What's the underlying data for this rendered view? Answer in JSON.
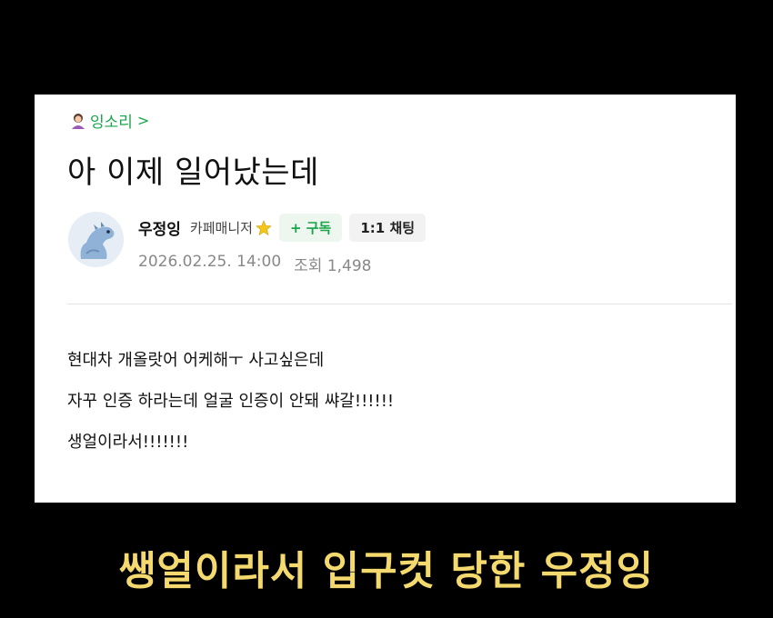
{
  "post": {
    "category": "잉소리",
    "category_chevron": ">",
    "title": "아 이제 일어났는데",
    "author": {
      "name": "우정잉",
      "role": "카페매니저",
      "subscribe_label": "+ 구독",
      "chat_label": "1:1 채팅"
    },
    "date": "2026.02.25. 14:00",
    "views": "조회 1,498",
    "body": [
      "현대차 개올랏어 어케해ㅜ 사고싶은데",
      "자꾸 인증 하라는데 얼굴 인증이 안돼 쌰갈!!!!!!",
      "생얼이라서!!!!!!!"
    ]
  },
  "caption": "쌩얼이라서 입구컷 당한 우정잉",
  "colors": {
    "background": "#000000",
    "accent_green": "#18a549",
    "caption_yellow": "#f4da6e"
  },
  "icons": {
    "category": "person-emoji-icon",
    "role_badge": "star-icon",
    "avatar": "dinosaur-avatar"
  }
}
